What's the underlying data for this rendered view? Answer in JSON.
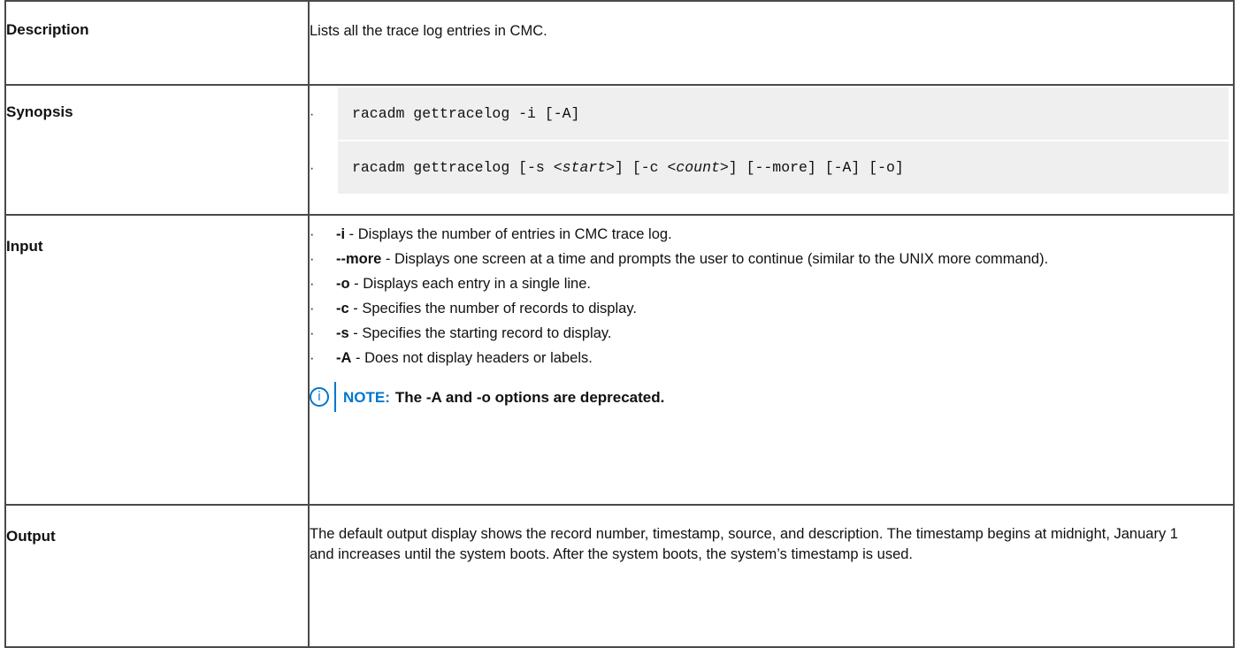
{
  "rows": {
    "description": {
      "label": "Description",
      "text": "Lists all the trace log entries in CMC."
    },
    "synopsis": {
      "label": "Synopsis",
      "bullet": "·",
      "cmd1": "racadm gettracelog -i [-A]",
      "cmd2_a": "racadm gettracelog [-s <",
      "cmd2_start": "start",
      "cmd2_b": ">] [-c <",
      "cmd2_count": "count",
      "cmd2_c": ">] [--more] [-A] [-o]"
    },
    "input": {
      "label": "Input",
      "options": [
        {
          "flag": "-i",
          "desc": " - Displays the number of entries in CMC trace log."
        },
        {
          "flag": "--more",
          "desc": " - Displays one screen at a time and prompts the user to continue (similar to the UNIX more command)."
        },
        {
          "flag": "-o",
          "desc": " - Displays each entry in a single line."
        },
        {
          "flag": "-c",
          "desc": " - Specifies the number of records to display."
        },
        {
          "flag": "-s",
          "desc": " - Specifies the starting record to display."
        },
        {
          "flag": "-A",
          "desc": " - Does not display headers or labels."
        }
      ],
      "note_icon": "info-icon",
      "note_label": "NOTE:",
      "note_text": "The -A and -o options are deprecated."
    },
    "output": {
      "label": "Output",
      "text": "The default output display shows the record number, timestamp, source, and description. The timestamp begins at midnight, January 1 and increases until the system boots. After the system boots, the system’s timestamp is used."
    }
  },
  "colors": {
    "border": "#4a4a4a",
    "code_bg": "#efefef",
    "note_accent": "#0076ce"
  }
}
